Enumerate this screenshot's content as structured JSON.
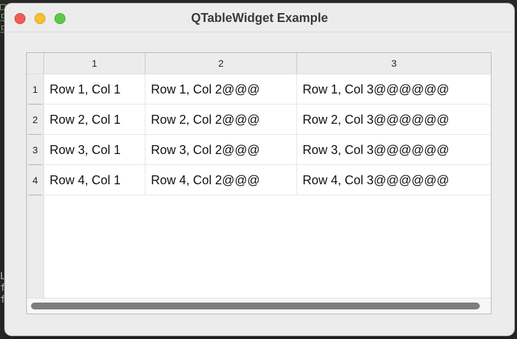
{
  "window": {
    "title": "QTableWidget Example"
  },
  "table": {
    "column_headers": [
      "1",
      "2",
      "3"
    ],
    "row_headers": [
      "1",
      "2",
      "3",
      "4"
    ],
    "rows": [
      [
        "Row 1, Col 1",
        "Row 1, Col 2@@@",
        "Row 1, Col 3@@@@@@"
      ],
      [
        "Row 2, Col 1",
        "Row 2, Col 2@@@",
        "Row 2, Col 3@@@@@@"
      ],
      [
        "Row 3, Col 1",
        "Row 3, Col 2@@@",
        "Row 3, Col 3@@@@@@"
      ],
      [
        "Row 4, Col 1",
        "Row 4, Col 2@@@",
        "Row 4, Col 3@@@@@@"
      ]
    ]
  },
  "background": {
    "top_fragment": [
      "□",
      "므",
      "므"
    ],
    "bottom_fragment": [
      "Le",
      "fo",
      "fo"
    ]
  },
  "colors": {
    "close": "#ee5e56",
    "minimize": "#f5bf2f",
    "maximize": "#5fc84b",
    "window_bg": "#ececec"
  }
}
